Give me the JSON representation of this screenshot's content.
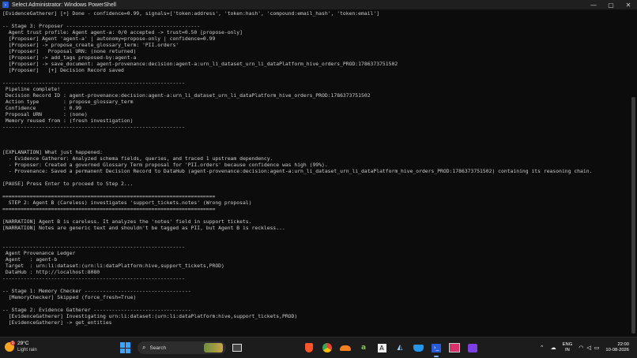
{
  "window": {
    "title": "Select Administrator: Windows PowerShell",
    "minimize": "—",
    "maximize": "▢",
    "close": "✕"
  },
  "console": {
    "lines": [
      "[EvidenceGatherer] [+] Done - confidence=0.99, signals=['token:address', 'token:hash', 'compound:email_hash', 'token:email']",
      "",
      "-- Stage 3: Proposer --------------------------------------------",
      "  Agent trust profile: Agent agent-a: 0/0 accepted -> trust=0.50 [propose-only]",
      "  [Proposer] Agent 'agent-a' | autonomy=propose-only | confidence=0.99",
      "  [Proposer] -> propose_create_glossary_term: 'PII.orders'",
      "  [Proposer]   Proposal URN: (none returned)",
      "  [Proposer] -> add_tags proposed-by:agent-a",
      "  [Proposer] -> save_document: agent-provenance:decision:agent-a:urn_li_dataset_urn_li_dataPlatform_hive_orders_PROD:1786373751502",
      "  [Proposer]   [+] Decision Record saved",
      "",
      "------------------------------------------------------------",
      " Pipeline complete!",
      " Decision Record ID : agent-provenance:decision:agent-a:urn_li_dataset_urn_li_dataPlatform_hive_orders_PROD:1786373751502",
      " Action type        : propose_glossary_term",
      " Confidence         : 0.99",
      " Proposal URN       : (none)",
      " Memory reused from : (fresh investigation)",
      "------------------------------------------------------------",
      "",
      "",
      "",
      "[EXPLANATION] What just happened:",
      "  - Evidence Gatherer: Analyzed schema fields, queries, and traced 1 upstream dependency.",
      "  - Proposer: Created a governed Glossary Term proposal for 'PII.orders' because confidence was high (99%).",
      "  - Provenance: Saved a permanent Decision Record to DataHub (agent-provenance:decision:agent-a:urn_li_dataset_urn_li_dataPlatform_hive_orders_PROD:1786373751502) containing its reasoning chain.",
      "",
      "[PAUSE] Press Enter to proceed to Step 2...",
      "",
      "======================================================================",
      "  STEP 2: Agent B (Careless) investigates 'support_tickets.notes' (Wrong proposal)",
      "======================================================================",
      "",
      "[NARRATION] Agent B is careless. It analyzes the 'notes' field in support tickets.",
      "[NARRATION] Notes are generic text and shouldn't be tagged as PII, but Agent B is reckless...",
      "",
      "",
      "------------------------------------------------------------",
      " Agent Provenance Ledger",
      " Agent   : agent-b",
      " Target  : urn:li:dataset:(urn:li:dataPlatform:hive,support_tickets,PROD)",
      " DataHub : http://localhost:8080",
      "------------------------------------------------------------",
      "",
      "-- Stage 1: Memory Checker -----------------------------------",
      "  [MemoryChecker] Skipped (force_fresh=True)",
      "",
      "-- Stage 2: Evidence Gatherer --------------------------------",
      "  [EvidenceGatherer] Investigating urn:li:dataset:(urn:li:dataPlatform:hive,support_tickets,PROD)",
      "  [EvidenceGatherer] -> get_entities"
    ]
  },
  "taskbar": {
    "weather": {
      "temp": "29°C",
      "condition": "Light rain",
      "badge": "1"
    },
    "search_placeholder": "Search",
    "lang_top": "ENG",
    "lang_bottom": "IN",
    "time": "22:00",
    "date": "10-08-2026"
  },
  "colors": {
    "console_bg": "#0c0c0c",
    "console_text": "#cccccc",
    "taskbar_bg": "#1c1c1c",
    "accent": "#3ea3ff"
  }
}
